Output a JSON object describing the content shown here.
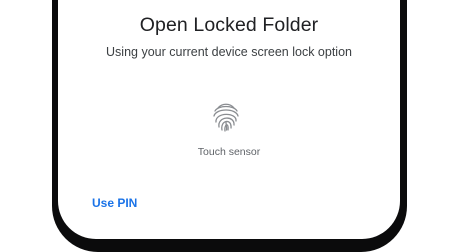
{
  "dialog": {
    "title": "Open Locked Folder",
    "subtitle": "Using your current device screen lock option",
    "sensor_label": "Touch sensor",
    "use_pin_label": "Use PIN"
  },
  "colors": {
    "accent": "#1a73e8",
    "title_text": "#202124",
    "body_text": "#3c4043",
    "muted_text": "#5f6368",
    "bezel": "#0b0b0c"
  },
  "icons": {
    "fingerprint": "fingerprint-icon"
  }
}
